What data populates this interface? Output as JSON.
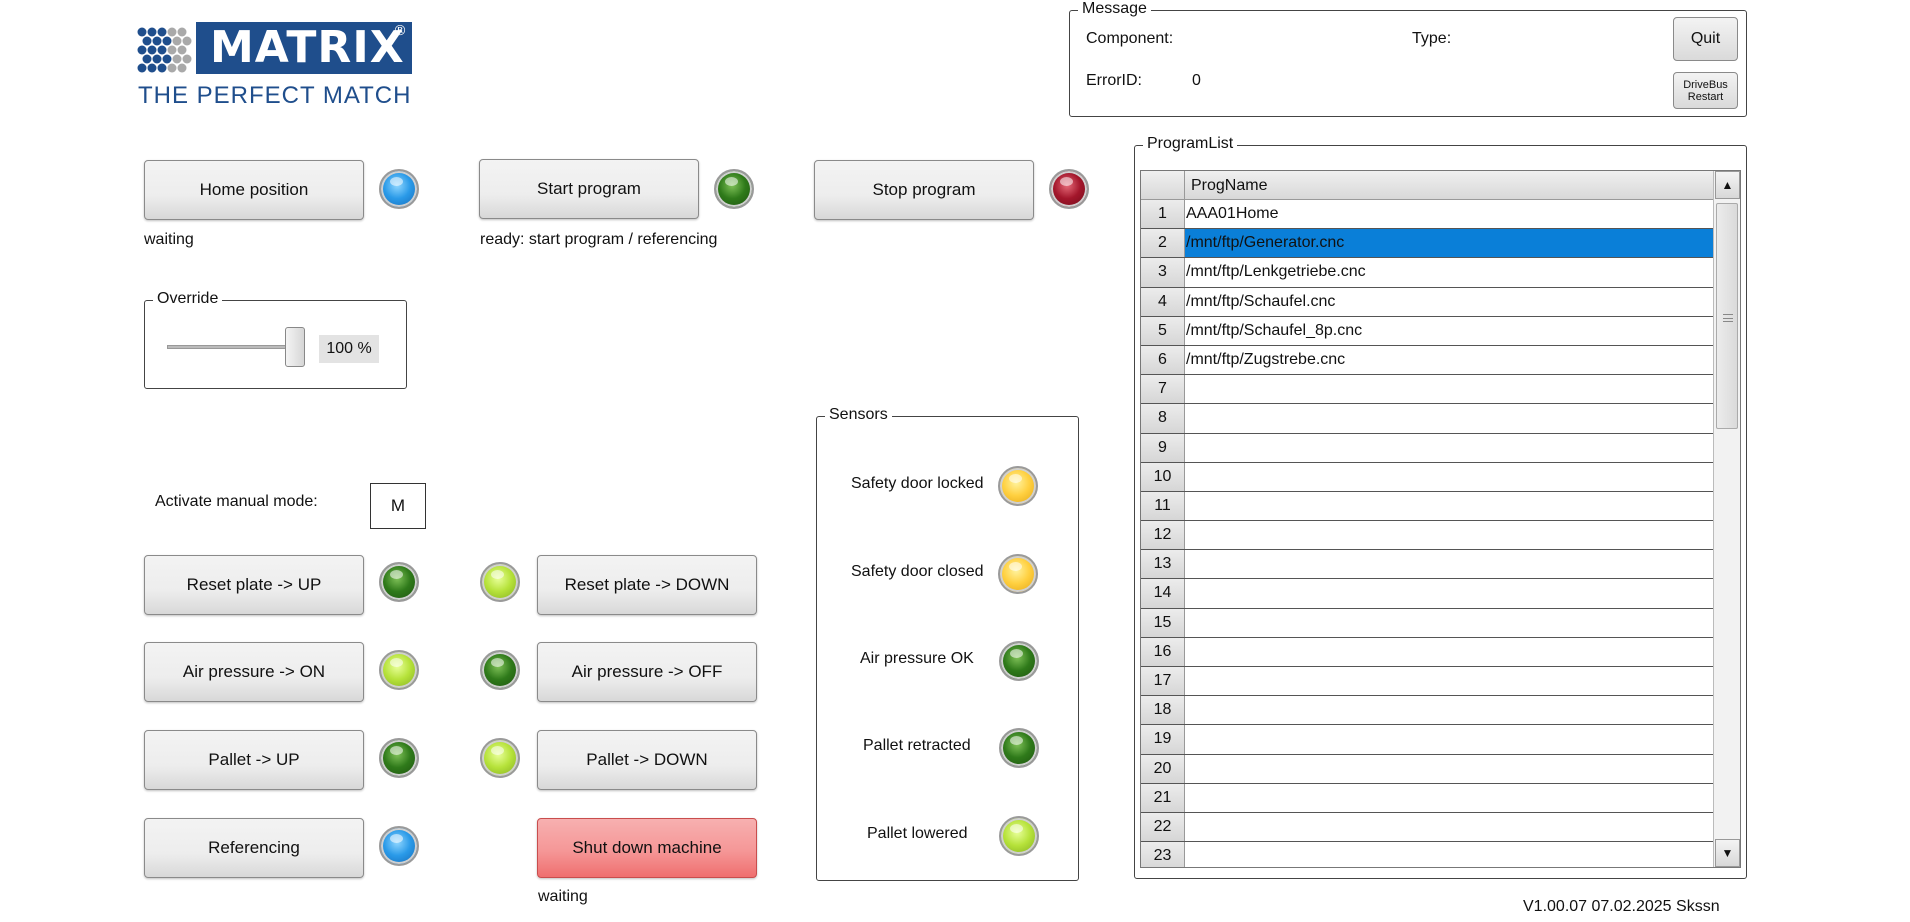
{
  "logo": {
    "brand": "MATRIX",
    "registered": "®",
    "tagline": "THE PERFECT MATCH",
    "color": "#1f4e8c"
  },
  "controls": {
    "home": {
      "label": "Home position",
      "status": "waiting",
      "lamp": "blue"
    },
    "start": {
      "label": "Start program",
      "status": "ready: start program / referencing",
      "lamp": "green"
    },
    "stop": {
      "label": "Stop program",
      "lamp": "red"
    }
  },
  "override": {
    "title": "Override",
    "value": "100 %",
    "level_percent": 100
  },
  "manual_mode": {
    "label": "Activate manual mode:",
    "key": "M"
  },
  "manual_buttons": {
    "reset_up": "Reset plate -> UP",
    "reset_down": "Reset plate -> DOWN",
    "air_on": "Air pressure -> ON",
    "air_off": "Air pressure -> OFF",
    "pallet_up": "Pallet -> UP",
    "pallet_down": "Pallet -> DOWN",
    "referencing": "Referencing",
    "shutdown": "Shut down machine",
    "shutdown_status": "waiting"
  },
  "sensors": {
    "title": "Sensors",
    "items": [
      {
        "label": "Safety door locked",
        "lamp": "yellow"
      },
      {
        "label": "Safety door closed",
        "lamp": "yellow"
      },
      {
        "label": "Air pressure OK",
        "lamp": "green"
      },
      {
        "label": "Pallet retracted",
        "lamp": "green"
      },
      {
        "label": "Pallet lowered",
        "lamp": "lime"
      }
    ]
  },
  "message": {
    "title": "Message",
    "component_label": "Component:",
    "type_label": "Type:",
    "errorid_label": "ErrorID:",
    "errorid_value": "0",
    "quit_label": "Quit",
    "drivebus_line1": "DriveBus",
    "drivebus_line2": "Restart"
  },
  "program_list": {
    "title": "ProgramList",
    "column": "ProgName",
    "selected_row": 2,
    "rows": [
      {
        "num": "1",
        "name": "AAA01Home"
      },
      {
        "num": "2",
        "name": "/mnt/ftp/Generator.cnc"
      },
      {
        "num": "3",
        "name": "/mnt/ftp/Lenkgetriebe.cnc"
      },
      {
        "num": "4",
        "name": "/mnt/ftp/Schaufel.cnc"
      },
      {
        "num": "5",
        "name": "/mnt/ftp/Schaufel_8p.cnc"
      },
      {
        "num": "6",
        "name": "/mnt/ftp/Zugstrebe.cnc"
      },
      {
        "num": "7",
        "name": ""
      },
      {
        "num": "8",
        "name": ""
      },
      {
        "num": "9",
        "name": ""
      },
      {
        "num": "10",
        "name": ""
      },
      {
        "num": "11",
        "name": ""
      },
      {
        "num": "12",
        "name": ""
      },
      {
        "num": "13",
        "name": ""
      },
      {
        "num": "14",
        "name": ""
      },
      {
        "num": "15",
        "name": ""
      },
      {
        "num": "16",
        "name": ""
      },
      {
        "num": "17",
        "name": ""
      },
      {
        "num": "18",
        "name": ""
      },
      {
        "num": "19",
        "name": ""
      },
      {
        "num": "20",
        "name": ""
      },
      {
        "num": "21",
        "name": ""
      },
      {
        "num": "22",
        "name": ""
      },
      {
        "num": "23",
        "name": ""
      }
    ]
  },
  "version": "V1.00.07 07.02.2025 Skssn"
}
